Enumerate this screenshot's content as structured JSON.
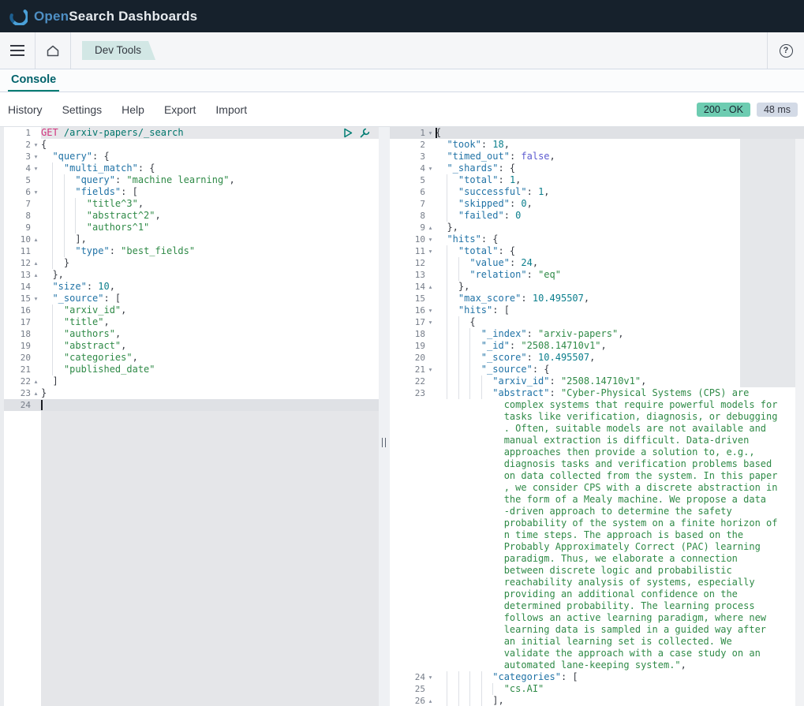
{
  "header": {
    "logo_open": "Open",
    "logo_rest": "Search Dashboards"
  },
  "nav": {
    "breadcrumb": "Dev Tools"
  },
  "tabs": {
    "console": "Console"
  },
  "toolbar": {
    "items": [
      "History",
      "Settings",
      "Help",
      "Export",
      "Import"
    ],
    "status_badge": "200 - OK",
    "time_badge": "48 ms"
  },
  "colors": {
    "teal": "#017d73",
    "key": "#2173a6",
    "str": "#2f8a47",
    "num": "#0b7e8c",
    "bool": "#5d5bd0",
    "method": "#d1337c",
    "url": "#00756b",
    "success": "#6dccb1",
    "timebg": "#d3dae6"
  },
  "request_editor": {
    "lines": [
      {
        "n": "1",
        "t": [
          [
            "m",
            "GET "
          ],
          [
            "u",
            "/arxiv-papers/_search"
          ]
        ],
        "hl": 1
      },
      {
        "n": "2",
        "f": "o",
        "t": [
          [
            "p",
            "{"
          ]
        ]
      },
      {
        "n": "3",
        "f": "o",
        "t": [
          [
            "p",
            "  "
          ],
          [
            "k",
            "\"query\""
          ],
          [
            "p",
            ": {"
          ]
        ]
      },
      {
        "n": "4",
        "f": "o",
        "t": [
          [
            "p",
            "    "
          ],
          [
            "k",
            "\"multi_match\""
          ],
          [
            "p",
            ": {"
          ]
        ]
      },
      {
        "n": "5",
        "t": [
          [
            "p",
            "      "
          ],
          [
            "k",
            "\"query\""
          ],
          [
            "p",
            ": "
          ],
          [
            "s",
            "\"machine learning\""
          ],
          [
            "p",
            ","
          ]
        ]
      },
      {
        "n": "6",
        "f": "o",
        "t": [
          [
            "p",
            "      "
          ],
          [
            "k",
            "\"fields\""
          ],
          [
            "p",
            ": ["
          ]
        ]
      },
      {
        "n": "7",
        "t": [
          [
            "p",
            "        "
          ],
          [
            "s",
            "\"title^3\""
          ],
          [
            "p",
            ","
          ]
        ]
      },
      {
        "n": "8",
        "t": [
          [
            "p",
            "        "
          ],
          [
            "s",
            "\"abstract^2\""
          ],
          [
            "p",
            ","
          ]
        ]
      },
      {
        "n": "9",
        "t": [
          [
            "p",
            "        "
          ],
          [
            "s",
            "\"authors^1\""
          ]
        ]
      },
      {
        "n": "10",
        "f": "c",
        "t": [
          [
            "p",
            "      ],"
          ]
        ]
      },
      {
        "n": "11",
        "t": [
          [
            "p",
            "      "
          ],
          [
            "k",
            "\"type\""
          ],
          [
            "p",
            ": "
          ],
          [
            "s",
            "\"best_fields\""
          ]
        ]
      },
      {
        "n": "12",
        "f": "c",
        "t": [
          [
            "p",
            "    }"
          ]
        ]
      },
      {
        "n": "13",
        "f": "c",
        "t": [
          [
            "p",
            "  },"
          ]
        ]
      },
      {
        "n": "14",
        "t": [
          [
            "p",
            "  "
          ],
          [
            "k",
            "\"size\""
          ],
          [
            "p",
            ": "
          ],
          [
            "num",
            "10"
          ],
          [
            "p",
            ","
          ]
        ]
      },
      {
        "n": "15",
        "f": "o",
        "t": [
          [
            "p",
            "  "
          ],
          [
            "k",
            "\"_source\""
          ],
          [
            "p",
            ": ["
          ]
        ]
      },
      {
        "n": "16",
        "t": [
          [
            "p",
            "    "
          ],
          [
            "s",
            "\"arxiv_id\""
          ],
          [
            "p",
            ","
          ]
        ]
      },
      {
        "n": "17",
        "t": [
          [
            "p",
            "    "
          ],
          [
            "s",
            "\"title\""
          ],
          [
            "p",
            ","
          ]
        ]
      },
      {
        "n": "18",
        "t": [
          [
            "p",
            "    "
          ],
          [
            "s",
            "\"authors\""
          ],
          [
            "p",
            ","
          ]
        ]
      },
      {
        "n": "19",
        "t": [
          [
            "p",
            "    "
          ],
          [
            "s",
            "\"abstract\""
          ],
          [
            "p",
            ","
          ]
        ]
      },
      {
        "n": "20",
        "t": [
          [
            "p",
            "    "
          ],
          [
            "s",
            "\"categories\""
          ],
          [
            "p",
            ","
          ]
        ]
      },
      {
        "n": "21",
        "t": [
          [
            "p",
            "    "
          ],
          [
            "s",
            "\"published_date\""
          ]
        ]
      },
      {
        "n": "22",
        "f": "c",
        "t": [
          [
            "p",
            "  ]"
          ]
        ]
      },
      {
        "n": "23",
        "f": "c",
        "t": [
          [
            "p",
            "}"
          ]
        ]
      },
      {
        "n": "24",
        "t": [],
        "hl": 2,
        "cursor": true
      }
    ]
  },
  "response_editor": {
    "lines": [
      {
        "n": "1",
        "f": "o",
        "t": [
          [
            "p",
            "{"
          ]
        ],
        "hl": 2,
        "cursor": true
      },
      {
        "n": "2",
        "t": [
          [
            "p",
            "  "
          ],
          [
            "k",
            "\"took\""
          ],
          [
            "p",
            ": "
          ],
          [
            "num",
            "18"
          ],
          [
            "p",
            ","
          ]
        ]
      },
      {
        "n": "3",
        "t": [
          [
            "p",
            "  "
          ],
          [
            "k",
            "\"timed_out\""
          ],
          [
            "p",
            ": "
          ],
          [
            "b",
            "false"
          ],
          [
            "p",
            ","
          ]
        ]
      },
      {
        "n": "4",
        "f": "o",
        "t": [
          [
            "p",
            "  "
          ],
          [
            "k",
            "\"_shards\""
          ],
          [
            "p",
            ": {"
          ]
        ]
      },
      {
        "n": "5",
        "t": [
          [
            "p",
            "    "
          ],
          [
            "k",
            "\"total\""
          ],
          [
            "p",
            ": "
          ],
          [
            "num",
            "1"
          ],
          [
            "p",
            ","
          ]
        ]
      },
      {
        "n": "6",
        "t": [
          [
            "p",
            "    "
          ],
          [
            "k",
            "\"successful\""
          ],
          [
            "p",
            ": "
          ],
          [
            "num",
            "1"
          ],
          [
            "p",
            ","
          ]
        ]
      },
      {
        "n": "7",
        "t": [
          [
            "p",
            "    "
          ],
          [
            "k",
            "\"skipped\""
          ],
          [
            "p",
            ": "
          ],
          [
            "num",
            "0"
          ],
          [
            "p",
            ","
          ]
        ]
      },
      {
        "n": "8",
        "t": [
          [
            "p",
            "    "
          ],
          [
            "k",
            "\"failed\""
          ],
          [
            "p",
            ": "
          ],
          [
            "num",
            "0"
          ]
        ]
      },
      {
        "n": "9",
        "f": "c",
        "t": [
          [
            "p",
            "  },"
          ]
        ]
      },
      {
        "n": "10",
        "f": "o",
        "t": [
          [
            "p",
            "  "
          ],
          [
            "k",
            "\"hits\""
          ],
          [
            "p",
            ": {"
          ]
        ]
      },
      {
        "n": "11",
        "f": "o",
        "t": [
          [
            "p",
            "    "
          ],
          [
            "k",
            "\"total\""
          ],
          [
            "p",
            ": {"
          ]
        ]
      },
      {
        "n": "12",
        "t": [
          [
            "p",
            "      "
          ],
          [
            "k",
            "\"value\""
          ],
          [
            "p",
            ": "
          ],
          [
            "num",
            "24"
          ],
          [
            "p",
            ","
          ]
        ]
      },
      {
        "n": "13",
        "t": [
          [
            "p",
            "      "
          ],
          [
            "k",
            "\"relation\""
          ],
          [
            "p",
            ": "
          ],
          [
            "s",
            "\"eq\""
          ]
        ]
      },
      {
        "n": "14",
        "f": "c",
        "t": [
          [
            "p",
            "    },"
          ]
        ]
      },
      {
        "n": "15",
        "t": [
          [
            "p",
            "    "
          ],
          [
            "k",
            "\"max_score\""
          ],
          [
            "p",
            ": "
          ],
          [
            "num",
            "10.495507"
          ],
          [
            "p",
            ","
          ]
        ]
      },
      {
        "n": "16",
        "f": "o",
        "t": [
          [
            "p",
            "    "
          ],
          [
            "k",
            "\"hits\""
          ],
          [
            "p",
            ": ["
          ]
        ]
      },
      {
        "n": "17",
        "f": "o",
        "t": [
          [
            "p",
            "      {"
          ]
        ]
      },
      {
        "n": "18",
        "t": [
          [
            "p",
            "        "
          ],
          [
            "k",
            "\"_index\""
          ],
          [
            "p",
            ": "
          ],
          [
            "s",
            "\"arxiv-papers\""
          ],
          [
            "p",
            ","
          ]
        ]
      },
      {
        "n": "19",
        "t": [
          [
            "p",
            "        "
          ],
          [
            "k",
            "\"_id\""
          ],
          [
            "p",
            ": "
          ],
          [
            "s",
            "\"2508.14710v1\""
          ],
          [
            "p",
            ","
          ]
        ]
      },
      {
        "n": "20",
        "t": [
          [
            "p",
            "        "
          ],
          [
            "k",
            "\"_score\""
          ],
          [
            "p",
            ": "
          ],
          [
            "num",
            "10.495507"
          ],
          [
            "p",
            ","
          ]
        ]
      },
      {
        "n": "21",
        "f": "o",
        "t": [
          [
            "p",
            "        "
          ],
          [
            "k",
            "\"_source\""
          ],
          [
            "p",
            ": {"
          ]
        ]
      },
      {
        "n": "22",
        "t": [
          [
            "p",
            "          "
          ],
          [
            "k",
            "\"arxiv_id\""
          ],
          [
            "p",
            ": "
          ],
          [
            "s",
            "\"2508.14710v1\""
          ],
          [
            "p",
            ","
          ]
        ]
      },
      {
        "n": "23",
        "t": [
          [
            "p",
            "          "
          ],
          [
            "k",
            "\"abstract\""
          ],
          [
            "p",
            ": "
          ],
          [
            "s",
            "\"Cyber-Physical Systems (CPS) are"
          ]
        ]
      },
      {
        "n": "",
        "w": true,
        "t": [
          [
            "s",
            "            complex systems that require powerful models for"
          ]
        ]
      },
      {
        "n": "",
        "w": true,
        "t": [
          [
            "s",
            "            tasks like verification, diagnosis, or debugging"
          ]
        ]
      },
      {
        "n": "",
        "w": true,
        "t": [
          [
            "s",
            "            . Often, suitable models are not available and"
          ]
        ]
      },
      {
        "n": "",
        "w": true,
        "t": [
          [
            "s",
            "            manual extraction is difficult. Data-driven"
          ]
        ]
      },
      {
        "n": "",
        "w": true,
        "t": [
          [
            "s",
            "            approaches then provide a solution to, e.g.,"
          ]
        ]
      },
      {
        "n": "",
        "w": true,
        "t": [
          [
            "s",
            "            diagnosis tasks and verification problems based"
          ]
        ]
      },
      {
        "n": "",
        "w": true,
        "t": [
          [
            "s",
            "            on data collected from the system. In this paper"
          ]
        ]
      },
      {
        "n": "",
        "w": true,
        "t": [
          [
            "s",
            "            , we consider CPS with a discrete abstraction in"
          ]
        ]
      },
      {
        "n": "",
        "w": true,
        "t": [
          [
            "s",
            "            the form of a Mealy machine. We propose a data"
          ]
        ]
      },
      {
        "n": "",
        "w": true,
        "t": [
          [
            "s",
            "            -driven approach to determine the safety"
          ]
        ]
      },
      {
        "n": "",
        "w": true,
        "t": [
          [
            "s",
            "            probability of the system on a finite horizon of"
          ]
        ]
      },
      {
        "n": "",
        "w": true,
        "t": [
          [
            "s",
            "            n time steps. The approach is based on the"
          ]
        ]
      },
      {
        "n": "",
        "w": true,
        "t": [
          [
            "s",
            "            Probably Approximately Correct (PAC) learning"
          ]
        ]
      },
      {
        "n": "",
        "w": true,
        "t": [
          [
            "s",
            "            paradigm. Thus, we elaborate a connection"
          ]
        ]
      },
      {
        "n": "",
        "w": true,
        "t": [
          [
            "s",
            "            between discrete logic and probabilistic"
          ]
        ]
      },
      {
        "n": "",
        "w": true,
        "t": [
          [
            "s",
            "            reachability analysis of systems, especially"
          ]
        ]
      },
      {
        "n": "",
        "w": true,
        "t": [
          [
            "s",
            "            providing an additional confidence on the"
          ]
        ]
      },
      {
        "n": "",
        "w": true,
        "t": [
          [
            "s",
            "            determined probability. The learning process"
          ]
        ]
      },
      {
        "n": "",
        "w": true,
        "t": [
          [
            "s",
            "            follows an active learning paradigm, where new"
          ]
        ]
      },
      {
        "n": "",
        "w": true,
        "t": [
          [
            "s",
            "            learning data is sampled in a guided way after"
          ]
        ]
      },
      {
        "n": "",
        "w": true,
        "t": [
          [
            "s",
            "            an initial learning set is collected. We"
          ]
        ]
      },
      {
        "n": "",
        "w": true,
        "t": [
          [
            "s",
            "            validate the approach with a case study on an"
          ]
        ]
      },
      {
        "n": "",
        "w": true,
        "t": [
          [
            "s",
            "            automated lane-keeping system.\""
          ],
          [
            "p",
            ","
          ]
        ]
      },
      {
        "n": "24",
        "f": "o",
        "t": [
          [
            "p",
            "          "
          ],
          [
            "k",
            "\"categories\""
          ],
          [
            "p",
            ": ["
          ]
        ]
      },
      {
        "n": "25",
        "t": [
          [
            "p",
            "            "
          ],
          [
            "s",
            "\"cs.AI\""
          ]
        ]
      },
      {
        "n": "26",
        "f": "c",
        "t": [
          [
            "p",
            "          ],"
          ]
        ]
      }
    ]
  }
}
